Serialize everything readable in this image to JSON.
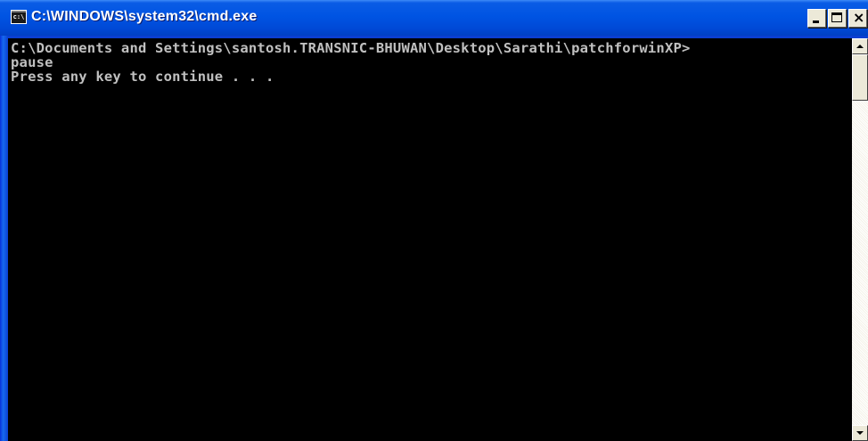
{
  "window": {
    "title": "C:\\WINDOWS\\system32\\cmd.exe",
    "app_icon": "cmd-icon",
    "app_icon_text": "c:\\",
    "controls": {
      "minimize_icon": "minimize-icon",
      "maximize_icon": "maximize-icon",
      "close_icon": "close-icon",
      "close_glyph": "×"
    },
    "title_bar_color": "#0054e3"
  },
  "console": {
    "background": "#000000",
    "text_color": "#c0c0c0",
    "lines": [
      "C:\\Documents and Settings\\santosh.TRANSNIC-BHUWAN\\Desktop\\Sarathi\\patchforwinXP>",
      "pause",
      "Press any key to continue . . ."
    ]
  },
  "scrollbar": {
    "up_icon": "scroll-up-arrow-icon",
    "down_icon": "scroll-down-arrow-icon"
  }
}
